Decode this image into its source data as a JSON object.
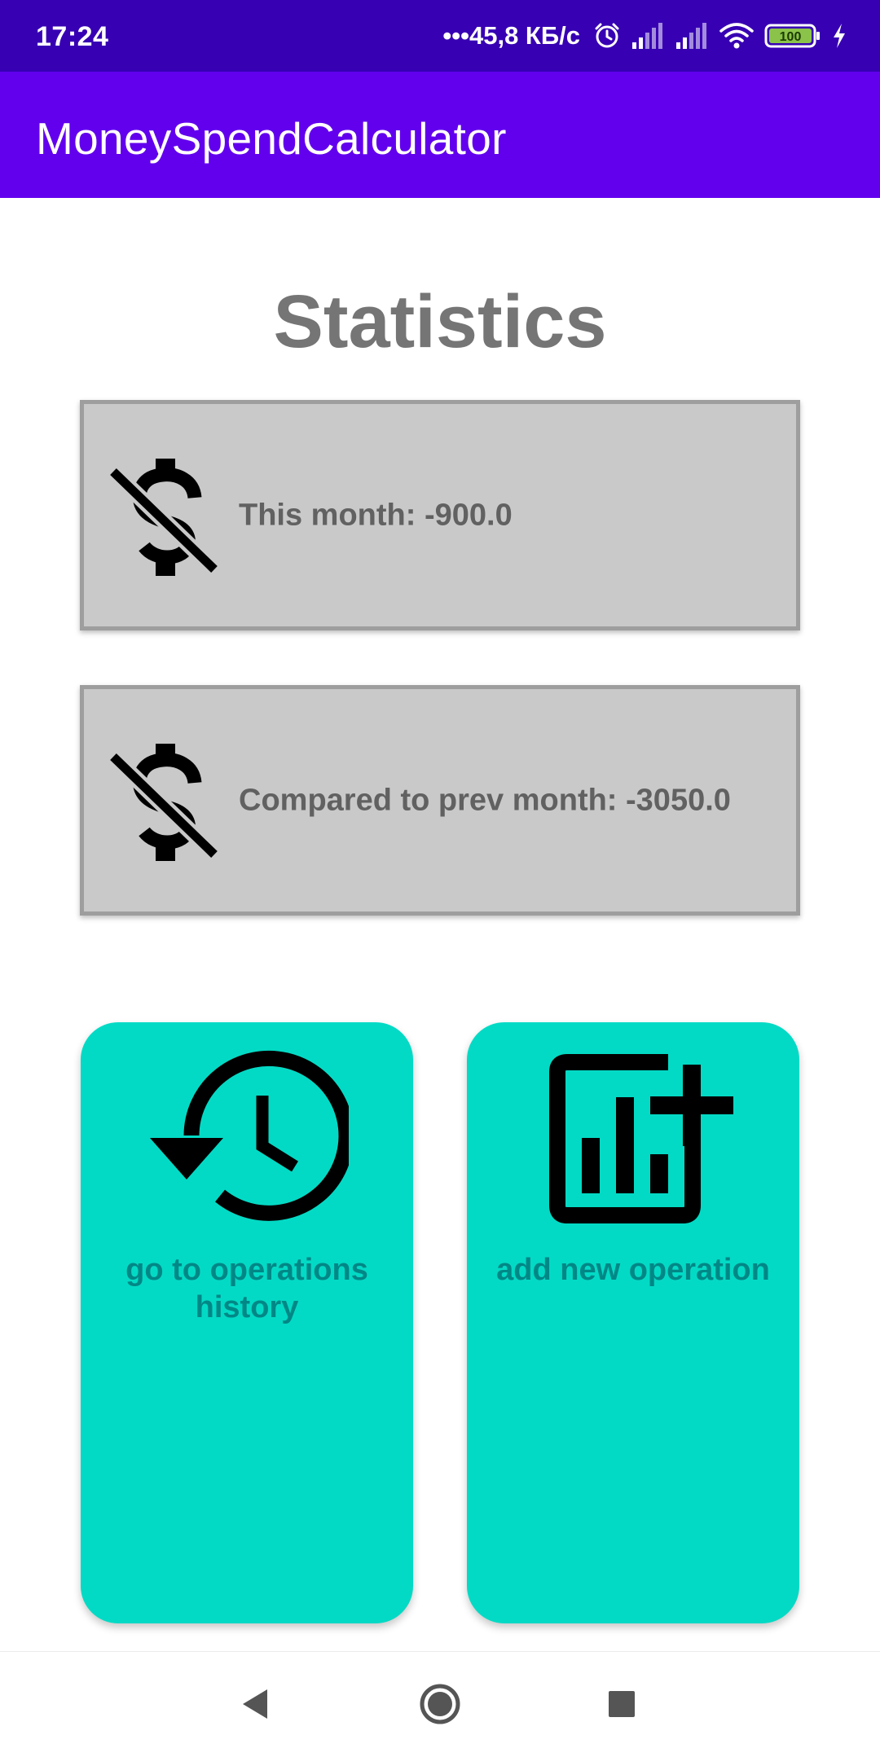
{
  "status_bar": {
    "time": "17:24",
    "dots": "•••",
    "network_speed": "45,8 КБ/с",
    "battery_level": "100",
    "icons": [
      "alarm-icon",
      "signal-icon",
      "signal-icon",
      "wifi-icon",
      "battery-icon",
      "charging-icon"
    ]
  },
  "app_bar": {
    "title": "MoneySpendCalculator",
    "color": "#6200ee"
  },
  "main": {
    "heading": "Statistics",
    "stats": [
      {
        "text": "This month: -900.0",
        "icon": "money-off-icon"
      },
      {
        "text": "Compared to prev month: -3050.0",
        "icon": "money-off-icon"
      }
    ],
    "actions": [
      {
        "label": "go to operations history",
        "icon": "history-icon"
      },
      {
        "label": "add new operation",
        "icon": "add-chart-icon"
      }
    ],
    "accent_color": "#03dac5"
  },
  "nav_bar": {
    "icons": [
      "back-icon",
      "home-icon",
      "recents-icon"
    ]
  }
}
